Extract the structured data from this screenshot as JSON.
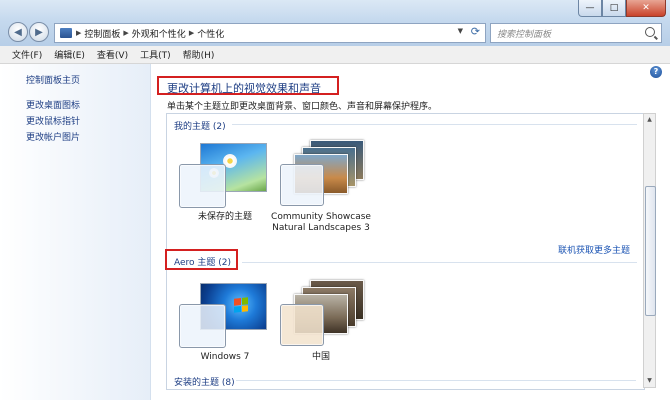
{
  "window": {
    "controls": {
      "minimize": "—",
      "maximize": "□",
      "close": "✕"
    },
    "nav": {
      "back": "◀",
      "forward": "▶",
      "dropdown": "▼"
    },
    "address": [
      "控制面板",
      "外观和个性化",
      "个性化"
    ],
    "search_placeholder": "搜索控制面板"
  },
  "menu": [
    "文件(F)",
    "编辑(E)",
    "查看(V)",
    "工具(T)",
    "帮助(H)"
  ],
  "sidebar": {
    "home": "控制面板主页",
    "items": [
      "更改桌面图标",
      "更改鼠标指针",
      "更改帐户图片"
    ]
  },
  "main": {
    "heading": "更改计算机上的视觉效果和声音",
    "subtitle": "单击某个主题立即更改桌面背景、窗口颜色、声音和屏幕保护程序。",
    "help": "?",
    "my_themes": {
      "label": "我的主题 (2)",
      "themes": [
        {
          "name": "未保存的主题"
        },
        {
          "name1": "Community Showcase",
          "name2": "Natural Landscapes 3"
        }
      ]
    },
    "online_link": "联机获取更多主题",
    "aero": {
      "label": "Aero 主题 (2)",
      "themes": [
        {
          "name": "Windows 7"
        },
        {
          "name": "中国"
        }
      ]
    },
    "installed_label": "安装的主题 (8)"
  },
  "colors": {
    "accent_red": "#d42020",
    "link_blue": "#1e56b4",
    "heading_blue": "#1e3e84"
  }
}
